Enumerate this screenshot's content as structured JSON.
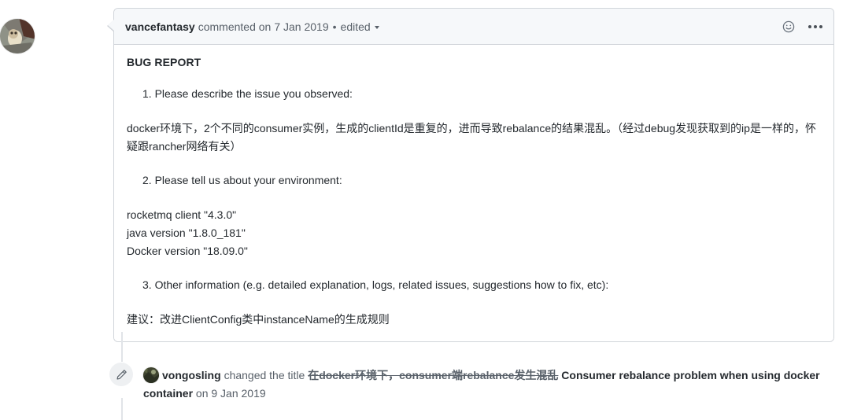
{
  "comment": {
    "author": "vancefantasy",
    "action": "commented on",
    "date": "7 Jan 2019",
    "separator": "•",
    "edited_label": "edited",
    "reaction_icon": "smiley-icon",
    "menu_icon": "kebab-horizontal-icon",
    "body": {
      "heading": "BUG REPORT",
      "item1": "1. Please describe the issue you observed:",
      "paragraph1": "docker环境下，2个不同的consumer实例，生成的clientId是重复的，进而导致rebalance的结果混乱。（经过debug发现获取到的ip是一样的，怀疑跟rancher网络有关）",
      "item2": "2. Please tell us about your environment:",
      "env_lines": [
        "rocketmq client \"4.3.0\"",
        "java version \"1.8.0_181\"",
        "Docker version \"18.09.0\""
      ],
      "item3": "3. Other information (e.g. detailed explanation, logs, related issues, suggestions how to fix, etc):",
      "paragraph2": "建议：改进ClientConfig类中instanceName的生成规则"
    }
  },
  "event": {
    "icon": "pencil-icon",
    "user": "vongosling",
    "action": "changed the title",
    "old_title": "在docker环境下，consumer端rebalance发生混乱",
    "new_title": "Consumer rebalance problem when using docker container",
    "date_prefix": "on",
    "date": "9 Jan 2019"
  },
  "colors": {
    "header_bg": "#f6f8fa",
    "border": "#d1d5da",
    "text": "#24292e",
    "muted": "#586069",
    "connector": "#e1e4e8"
  }
}
